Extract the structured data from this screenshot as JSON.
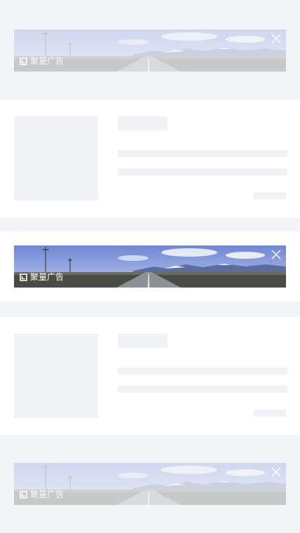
{
  "ads": [
    {
      "label": "聚量广告",
      "state": "faded"
    },
    {
      "label": "聚量广告",
      "state": "active"
    },
    {
      "label": "聚量广告",
      "state": "faded"
    }
  ],
  "icons": {
    "close": "close-icon",
    "brand": "ad-brand-logo-icon"
  },
  "colors": {
    "page_background": "#f2f3f6",
    "card_background": "#ffffff",
    "skeleton": "#f1f2f5",
    "sky": "#7e92d8"
  }
}
